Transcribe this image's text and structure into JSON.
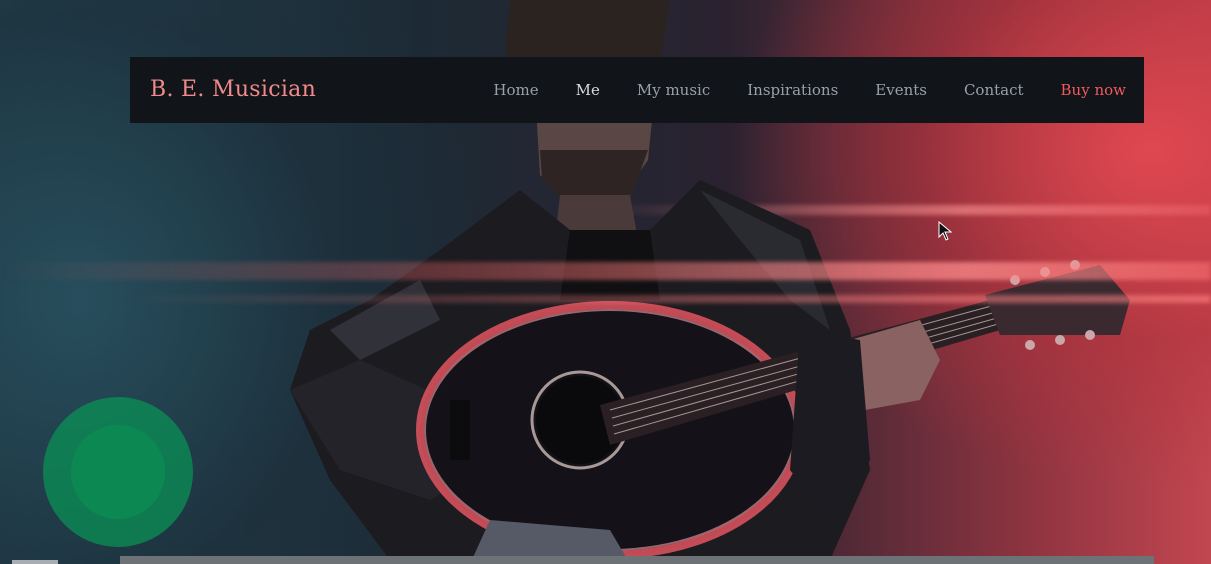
{
  "brand": {
    "name": "B. E. Musician"
  },
  "nav": {
    "items": [
      {
        "label": "Home"
      },
      {
        "label": "Me"
      },
      {
        "label": "My music"
      },
      {
        "label": "Inspirations"
      },
      {
        "label": "Events"
      },
      {
        "label": "Contact"
      },
      {
        "label": "Buy now"
      }
    ]
  },
  "colors": {
    "brand": "#f08a8c",
    "nav_text": "#9aa0a8",
    "nav_active": "#d8dadf",
    "cta": "#f0595f",
    "navbar_bg": "#111418",
    "record_indicator": "#0c8c52"
  },
  "hero": {
    "image": "man-playing-acoustic-guitar-with-red-light-flare"
  }
}
